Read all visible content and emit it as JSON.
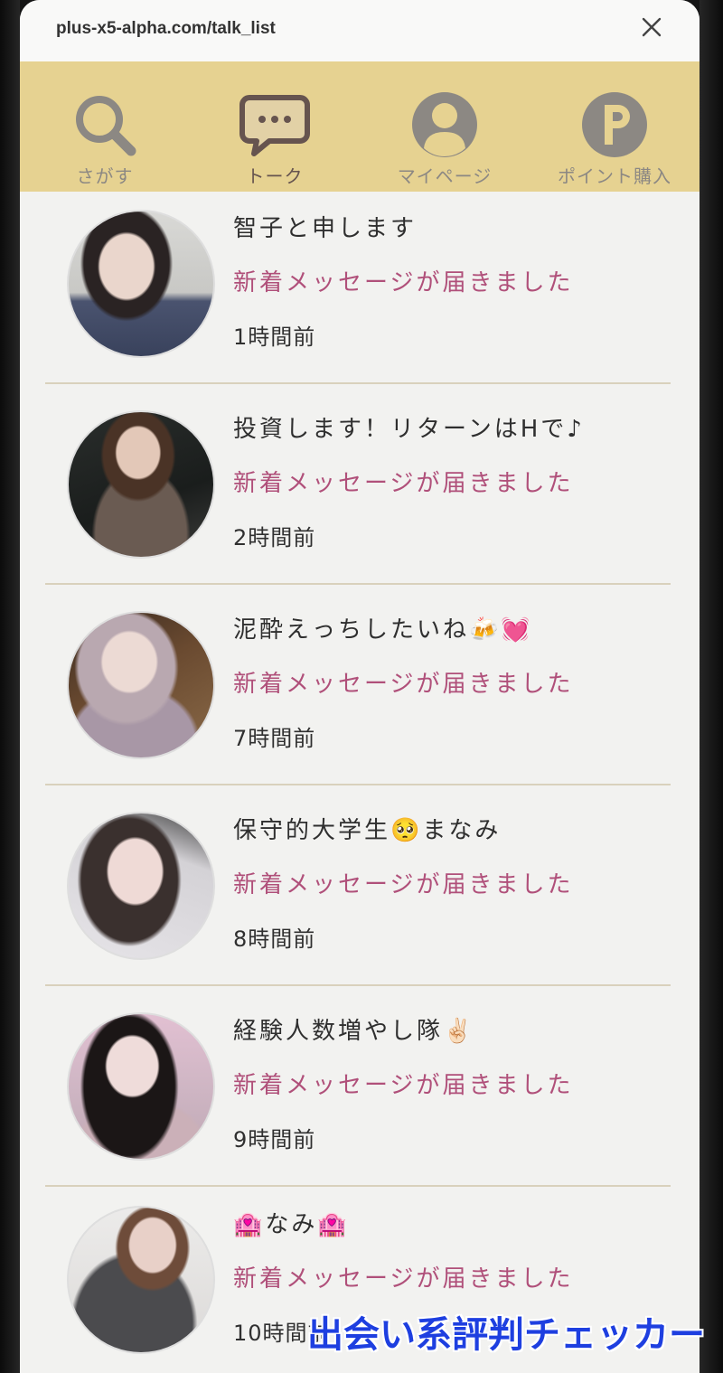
{
  "browser": {
    "url": "plus-x5-alpha.com/talk_list",
    "close_icon": "close-icon"
  },
  "nav": {
    "background": "#e6d291",
    "active_color": "#66544f",
    "inactive_color": "#8c8883",
    "items": [
      {
        "label": "さがす",
        "icon": "search-icon",
        "active": false
      },
      {
        "label": "トーク",
        "icon": "chat-bubble-icon",
        "active": true
      },
      {
        "label": "マイページ",
        "icon": "user-circle-icon",
        "active": false
      },
      {
        "label": "ポイント購入",
        "icon": "point-p-icon",
        "active": false
      }
    ]
  },
  "talks": [
    {
      "name": "智子と申します",
      "message": "新着メッセージが届きました",
      "time": "1時間前"
    },
    {
      "name": "投資します！リターンはHで♪",
      "message": "新着メッセージが届きました",
      "time": "2時間前"
    },
    {
      "name": "泥酔えっちしたいね🍻💓",
      "message": "新着メッセージが届きました",
      "time": "7時間前"
    },
    {
      "name": "保守的大学生🥺まなみ",
      "message": "新着メッセージが届きました",
      "time": "8時間前"
    },
    {
      "name": "経験人数増やし隊✌🏻",
      "message": "新着メッセージが届きました",
      "time": "9時間前"
    },
    {
      "name": "🏩なみ🏩",
      "message": "新着メッセージが届きました",
      "time": "10時間前"
    }
  ],
  "colors": {
    "page_background": "#f2f2f0",
    "message_text": "#b0507a",
    "divider": "#d9d1bc"
  },
  "watermark": {
    "text": "出会い系評判チェッカー",
    "color": "#1e3fe0"
  }
}
